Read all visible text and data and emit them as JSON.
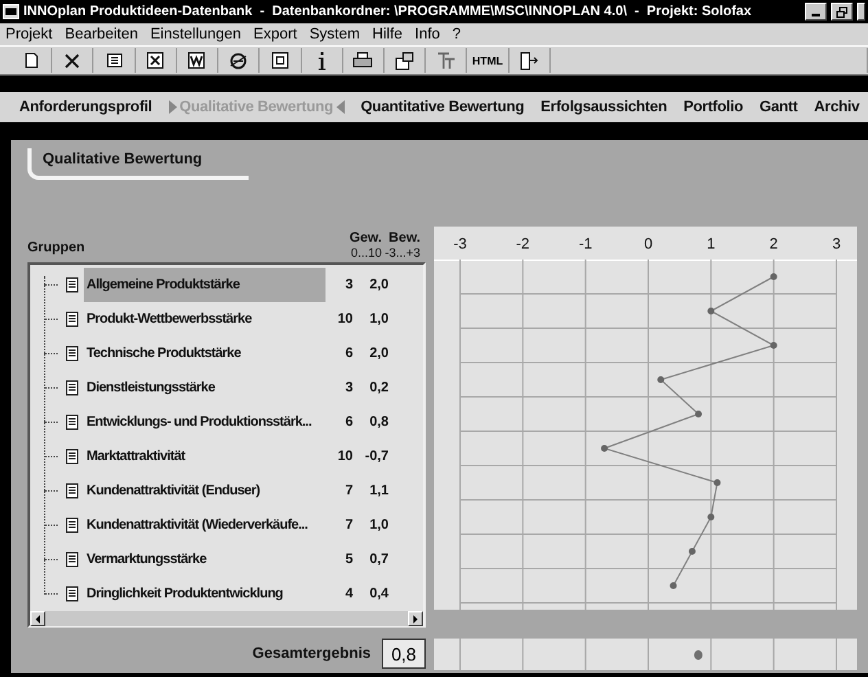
{
  "window": {
    "title": "INNOplan Produktideen-Datenbank  -  Datenbankordner: \\PROGRAMME\\MSC\\INNOPLAN 4.0\\  -  Projekt: Solofax"
  },
  "menu": [
    "Projekt",
    "Bearbeiten",
    "Einstellungen",
    "Export",
    "System",
    "Hilfe",
    "Info",
    "?"
  ],
  "toolbar": [
    {
      "kind": "new"
    },
    {
      "kind": "delete"
    },
    {
      "kind": "list"
    },
    {
      "kind": "excel"
    },
    {
      "kind": "word"
    },
    {
      "kind": "browser"
    },
    {
      "kind": "window"
    },
    {
      "kind": "info"
    },
    {
      "kind": "print"
    },
    {
      "kind": "properties"
    },
    {
      "kind": "font"
    },
    {
      "kind": "text",
      "label": "HTML"
    },
    {
      "kind": "exit"
    }
  ],
  "tabs": [
    {
      "label": "Anforderungsprofil",
      "selected": false
    },
    {
      "label": "Qualitative Bewertung",
      "selected": true
    },
    {
      "label": "Quantitative Bewertung",
      "selected": false
    },
    {
      "label": "Erfolgsaussichten",
      "selected": false
    },
    {
      "label": "Portfolio",
      "selected": false
    },
    {
      "label": "Gantt",
      "selected": false
    },
    {
      "label": "Archiv",
      "selected": false
    }
  ],
  "section_title": "Qualitative Bewertung",
  "table": {
    "columns": [
      {
        "title": "Gruppen"
      },
      {
        "title": "Gew.",
        "range": "0...10"
      },
      {
        "title": "Bew.",
        "range": "-3...+3"
      }
    ],
    "rows": [
      {
        "name": "Allgemeine Produktstärke",
        "weight": "3",
        "rating": "2,0",
        "selected": true
      },
      {
        "name": "Produkt-Wettbewerbsstärke",
        "weight": "10",
        "rating": "1,0",
        "selected": false
      },
      {
        "name": "Technische Produktstärke",
        "weight": "6",
        "rating": "2,0",
        "selected": false
      },
      {
        "name": "Dienstleistungsstärke",
        "weight": "3",
        "rating": "0,2",
        "selected": false
      },
      {
        "name": "Entwicklungs- und Produktionsstärk...",
        "weight": "6",
        "rating": "0,8",
        "selected": false
      },
      {
        "name": "Marktattraktivität",
        "weight": "10",
        "rating": "-0,7",
        "selected": false
      },
      {
        "name": "Kundenattraktivität (Enduser)",
        "weight": "7",
        "rating": "1,1",
        "selected": false
      },
      {
        "name": "Kundenattraktivität (Wiederverkäufe...",
        "weight": "7",
        "rating": "1,0",
        "selected": false
      },
      {
        "name": "Vermarktungsstärke",
        "weight": "5",
        "rating": "0,7",
        "selected": false
      },
      {
        "name": "Dringlichkeit Produktentwicklung",
        "weight": "4",
        "rating": "0,4",
        "selected": false
      }
    ]
  },
  "chart_data": {
    "type": "line",
    "orientation": "horizontal",
    "grid": true,
    "series": [
      {
        "color": "#808080",
        "marker": true,
        "values": [
          2.0,
          1.0,
          2.0,
          0.2,
          0.8,
          -0.7,
          1.1,
          1.0,
          0.7,
          0.4
        ]
      }
    ],
    "xlim": [
      -3,
      3
    ],
    "xticks": [
      -3,
      -2,
      -1,
      0,
      1,
      2,
      3
    ]
  },
  "total": {
    "label": "Gesamtergebnis",
    "value": "0,8",
    "level": 0.633
  }
}
